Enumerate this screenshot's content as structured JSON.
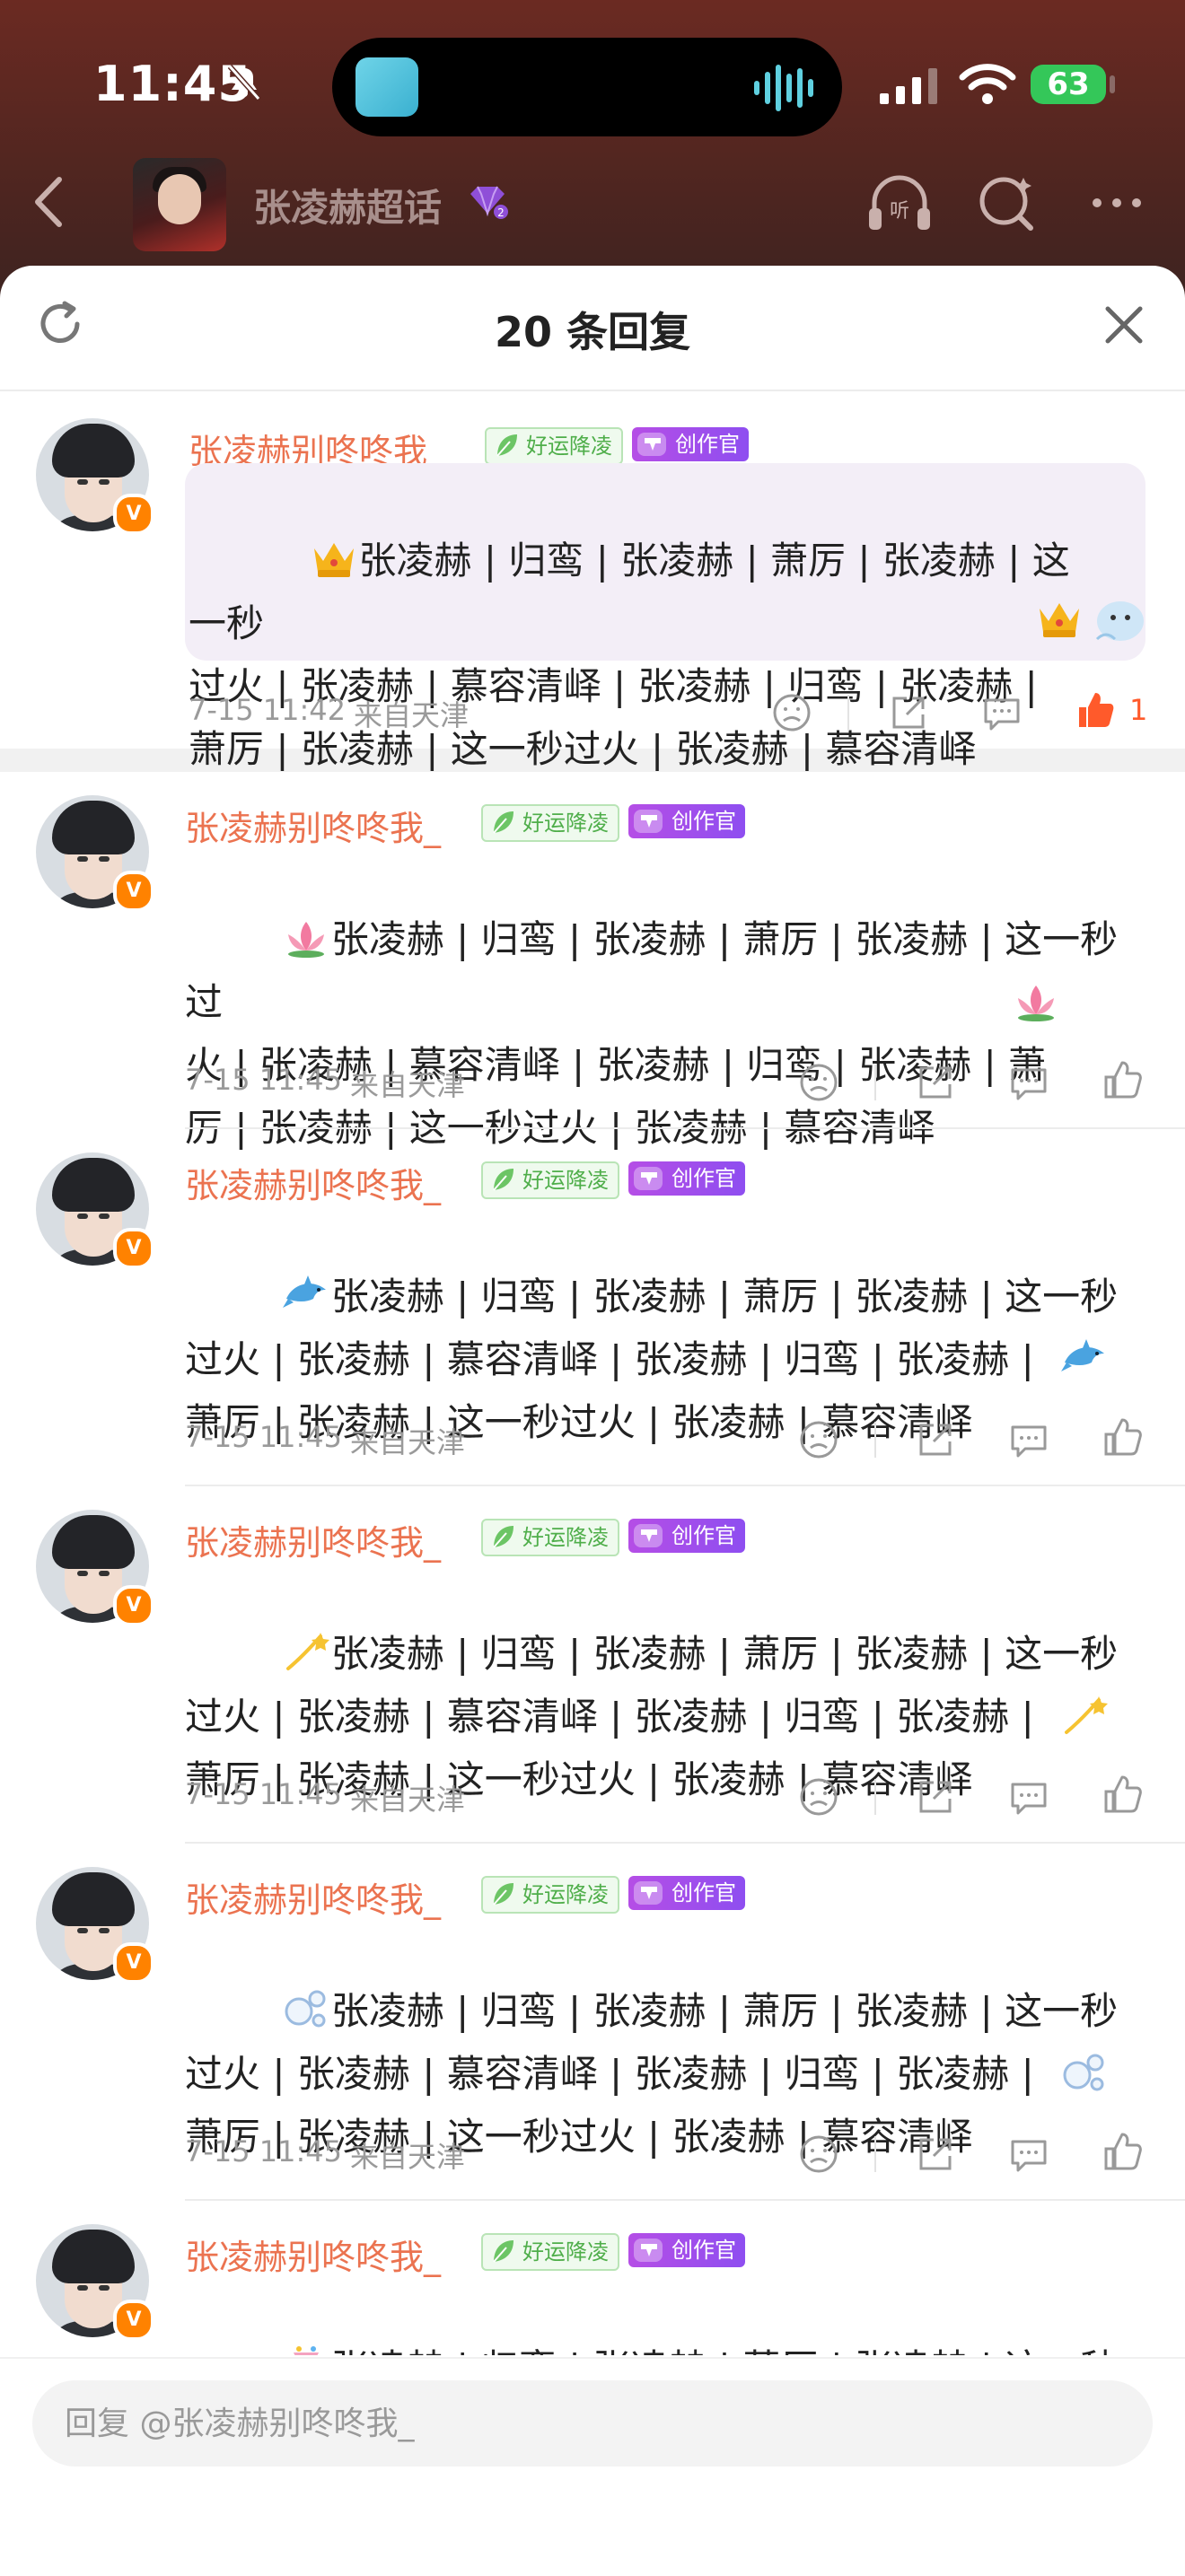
{
  "status_bar": {
    "time": "11:45",
    "battery": "63"
  },
  "header": {
    "title": "张凌赫超话"
  },
  "sheet": {
    "title": "20 条回复"
  },
  "comments": [
    {
      "username": "张凌赫别咚咚我_",
      "tag_good": "好运降凌",
      "tag_create": "创作官",
      "emoji": "crown-emoji",
      "text": "张凌赫 | 归鸾 | 张凌赫 | 萧厉 | 张凌赫 | 这一秒\n过火 | 张凌赫 | 慕容清峄 | 张凌赫 | 归鸾 | 张凌赫 |\n萧厉 | 张凌赫 | 这一秒过火 | 张凌赫 | 慕容清峄",
      "date": "7-15 11:42",
      "location": "来自天津",
      "likes": "1"
    },
    {
      "username": "张凌赫别咚咚我_",
      "tag_good": "好运降凌",
      "tag_create": "创作官",
      "emoji": "lotus-emoji",
      "text": "张凌赫 | 归鸾 | 张凌赫 | 萧厉 | 张凌赫 | 这一秒过\n火 | 张凌赫 | 慕容清峄 | 张凌赫 | 归鸾 | 张凌赫 | 萧\n厉 | 张凌赫 | 这一秒过火 | 张凌赫 | 慕容清峄",
      "date": "7-15 11:45",
      "location": "来自天津",
      "likes": ""
    },
    {
      "username": "张凌赫别咚咚我_",
      "tag_good": "好运降凌",
      "tag_create": "创作官",
      "emoji": "dolphin-emoji",
      "text": "张凌赫 | 归鸾 | 张凌赫 | 萧厉 | 张凌赫 | 这一秒\n过火 | 张凌赫 | 慕容清峄 | 张凌赫 | 归鸾 | 张凌赫 |\n萧厉 | 张凌赫 | 这一秒过火 | 张凌赫 | 慕容清峄",
      "date": "7-15 11:45",
      "location": "来自天津",
      "likes": ""
    },
    {
      "username": "张凌赫别咚咚我_",
      "tag_good": "好运降凌",
      "tag_create": "创作官",
      "emoji": "dizzy-star-emoji",
      "text": "张凌赫 | 归鸾 | 张凌赫 | 萧厉 | 张凌赫 | 这一秒\n过火 | 张凌赫 | 慕容清峄 | 张凌赫 | 归鸾 | 张凌赫 |\n萧厉 | 张凌赫 | 这一秒过火 | 张凌赫 | 慕容清峄",
      "date": "7-15 11:45",
      "location": "来自天津",
      "likes": ""
    },
    {
      "username": "张凌赫别咚咚我_",
      "tag_good": "好运降凌",
      "tag_create": "创作官",
      "emoji": "bubbles-emoji",
      "text": "张凌赫 | 归鸾 | 张凌赫 | 萧厉 | 张凌赫 | 这一秒\n过火 | 张凌赫 | 慕容清峄 | 张凌赫 | 归鸾 | 张凌赫 |\n萧厉 | 张凌赫 | 这一秒过火 | 张凌赫 | 慕容清峄",
      "date": "7-15 11:45",
      "location": "来自天津",
      "likes": ""
    },
    {
      "username": "张凌赫别咚咚我_",
      "tag_good": "好运降凌",
      "tag_create": "创作官",
      "emoji": "confetti-emoji",
      "text": "张凌赫 | 归鸾 | 张凌赫 | 萧厉 | 张凌赫 | 这一秒",
      "date": "",
      "location": "",
      "likes": ""
    }
  ],
  "reply": {
    "placeholder": "回复 @张凌赫别咚咚我_"
  },
  "colors": {
    "username": "#eb7350",
    "like_active": "#ff5a2b",
    "create_tag": "#a14eec",
    "good_tag": "#4fae4a"
  }
}
